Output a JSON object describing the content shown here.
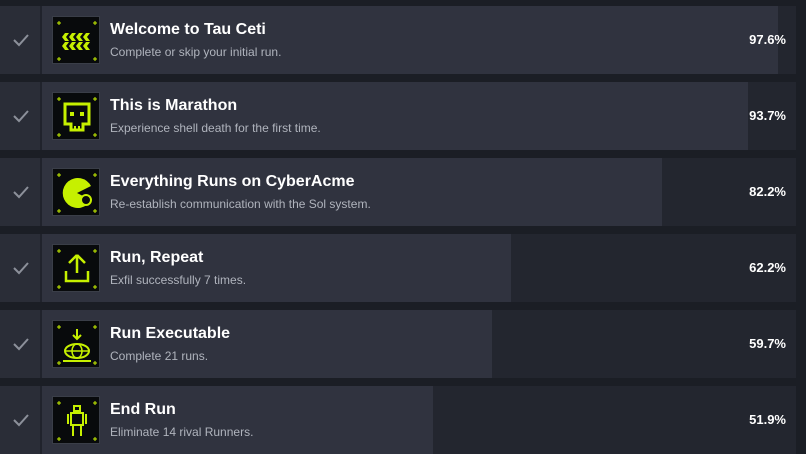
{
  "colors": {
    "accent": "#c6f000",
    "row_bg": "#20232c",
    "bar_fill": "#30333f",
    "text": "#ffffff",
    "subtext": "#b0b4bd"
  },
  "achievements": [
    {
      "title": "Welcome to Tau Ceti",
      "description": "Complete or skip your initial run.",
      "percent_label": "97.6%",
      "percent": 97.6,
      "icon": "chevron-pattern-icon"
    },
    {
      "title": "This is Marathon",
      "description": "Experience shell death for the first time.",
      "percent_label": "93.7%",
      "percent": 93.7,
      "icon": "skull-icon"
    },
    {
      "title": "Everything Runs on CyberAcme",
      "description": "Re-establish communication with the Sol system.",
      "percent_label": "82.2%",
      "percent": 82.2,
      "icon": "pac-signal-icon"
    },
    {
      "title": "Run, Repeat",
      "description": "Exfil successfully 7 times.",
      "percent_label": "62.2%",
      "percent": 62.2,
      "icon": "box-upload-icon"
    },
    {
      "title": "Run Executable",
      "description": "Complete 21 runs.",
      "percent_label": "59.7%",
      "percent": 59.7,
      "icon": "globe-download-icon"
    },
    {
      "title": "End Run",
      "description": "Eliminate 14 rival Runners.",
      "percent_label": "51.9%",
      "percent": 51.9,
      "icon": "runner-figure-icon"
    }
  ]
}
